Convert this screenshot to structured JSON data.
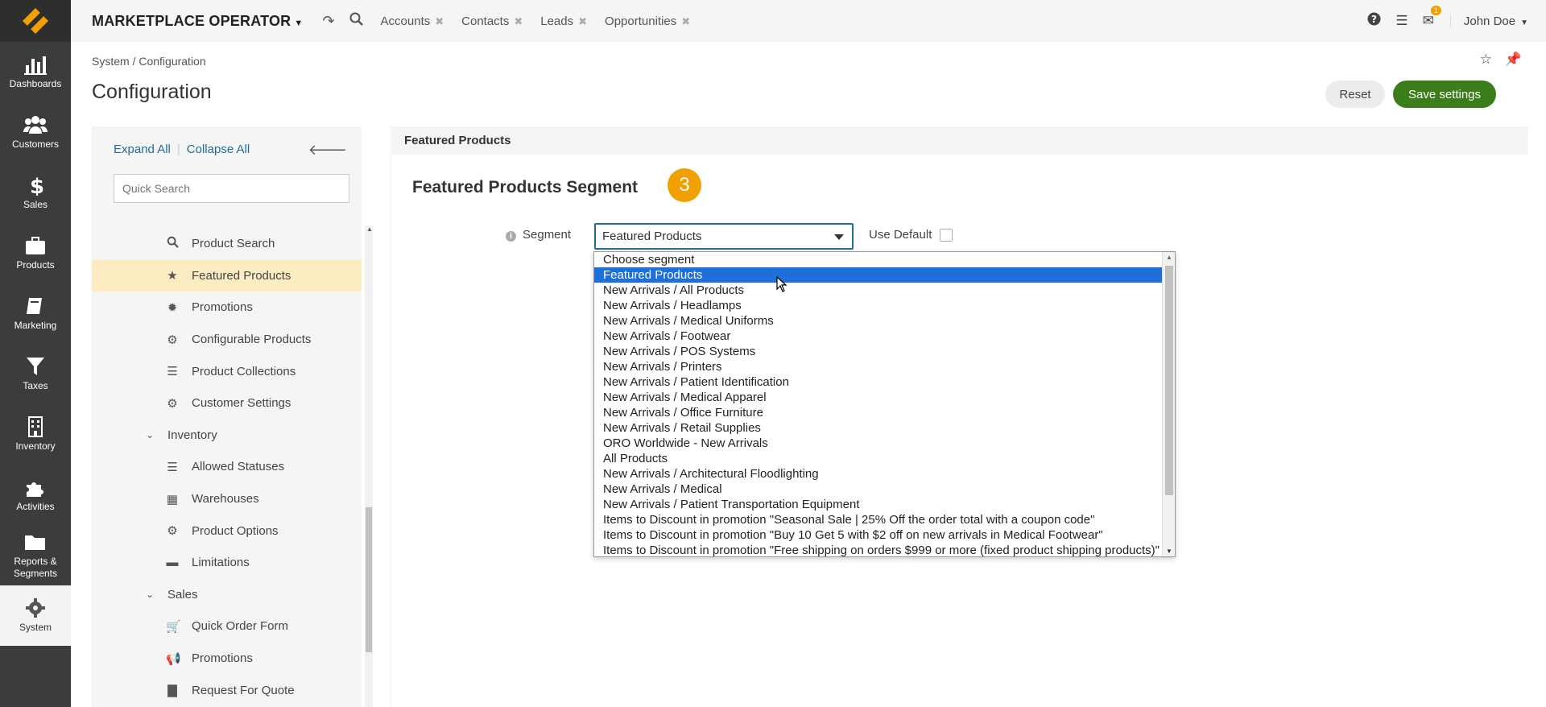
{
  "nav": {
    "items": [
      {
        "label": "Dashboards",
        "icon": "bar-chart-icon"
      },
      {
        "label": "Customers",
        "icon": "users-icon"
      },
      {
        "label": "Sales",
        "icon": "dollar-icon"
      },
      {
        "label": "Products",
        "icon": "briefcase-icon"
      },
      {
        "label": "Marketing",
        "icon": "book-icon"
      },
      {
        "label": "Taxes",
        "icon": "filter-icon"
      },
      {
        "label": "Inventory",
        "icon": "building-icon"
      },
      {
        "label": "Activities",
        "icon": "puzzle-icon"
      },
      {
        "label": "Reports & Segments",
        "icon": "folder-icon"
      },
      {
        "label": "System",
        "icon": "gear-icon"
      }
    ]
  },
  "topbar": {
    "org_name": "MARKETPLACE OPERATOR",
    "pinned": [
      "Accounts",
      "Contacts",
      "Leads",
      "Opportunities"
    ],
    "notifications_count": "1",
    "user_name": "John Doe"
  },
  "page": {
    "breadcrumb": "System / Configuration",
    "title": "Configuration",
    "reset_label": "Reset",
    "save_label": "Save settings"
  },
  "sidebar": {
    "expand_all": "Expand All",
    "collapse_all": "Collapse All",
    "search_placeholder": "Quick Search",
    "tree": [
      {
        "label": "Product Search",
        "icon": "search-icon",
        "level": 2
      },
      {
        "label": "Featured Products",
        "icon": "star-icon",
        "level": 2,
        "active": true
      },
      {
        "label": "Promotions",
        "icon": "badge-icon",
        "level": 2
      },
      {
        "label": "Configurable Products",
        "icon": "gear-icon",
        "level": 2
      },
      {
        "label": "Product Collections",
        "icon": "list-icon",
        "level": 2
      },
      {
        "label": "Customer Settings",
        "icon": "gears-icon",
        "level": 2
      },
      {
        "label": "Inventory",
        "icon": "chevron-down-icon",
        "level": 1
      },
      {
        "label": "Allowed Statuses",
        "icon": "list-icon",
        "level": 2
      },
      {
        "label": "Warehouses",
        "icon": "building-icon",
        "level": 2
      },
      {
        "label": "Product Options",
        "icon": "gears-icon",
        "level": 2
      },
      {
        "label": "Limitations",
        "icon": "minus-icon",
        "level": 2
      },
      {
        "label": "Sales",
        "icon": "chevron-down-icon",
        "level": 1
      },
      {
        "label": "Quick Order Form",
        "icon": "cart-icon",
        "level": 2
      },
      {
        "label": "Promotions",
        "icon": "bullhorn-icon",
        "level": 2
      },
      {
        "label": "Request For Quote",
        "icon": "file-icon",
        "level": 2
      }
    ]
  },
  "main": {
    "section_title": "Featured Products",
    "segment_title": "Featured Products Segment",
    "step_number": "3",
    "segment_label": "Segment",
    "segment_value": "Featured Products",
    "use_default_label": "Use Default",
    "options": [
      "Choose segment",
      "Featured Products",
      "New Arrivals / All Products",
      "New Arrivals / Headlamps",
      "New Arrivals / Medical Uniforms",
      "New Arrivals / Footwear",
      "New Arrivals / POS Systems",
      "New Arrivals / Printers",
      "New Arrivals / Patient Identification",
      "New Arrivals / Medical Apparel",
      "New Arrivals / Office Furniture",
      "New Arrivals / Retail Supplies",
      "ORO Worldwide - New Arrivals",
      "All Products",
      "New Arrivals / Architectural Floodlighting",
      "New Arrivals / Medical",
      "New Arrivals / Patient Transportation Equipment",
      "Items to Discount in promotion \"Seasonal Sale | 25% Off the order total with a coupon code\"",
      "Items to Discount in promotion \"Buy 10 Get 5 with $2 off on new arrivals in Medical Footwear\"",
      "Items to Discount in promotion \"Free shipping on orders $999 or more (fixed product shipping products)\""
    ],
    "selected_option_index": 1
  },
  "colors": {
    "nav_bg": "#3c3c3c",
    "accent_green": "#3a7d1a",
    "link_blue": "#1f6d99",
    "highlight": "#fdebc1",
    "step_orange": "#f0a000",
    "option_selected": "#1e6fd9"
  }
}
